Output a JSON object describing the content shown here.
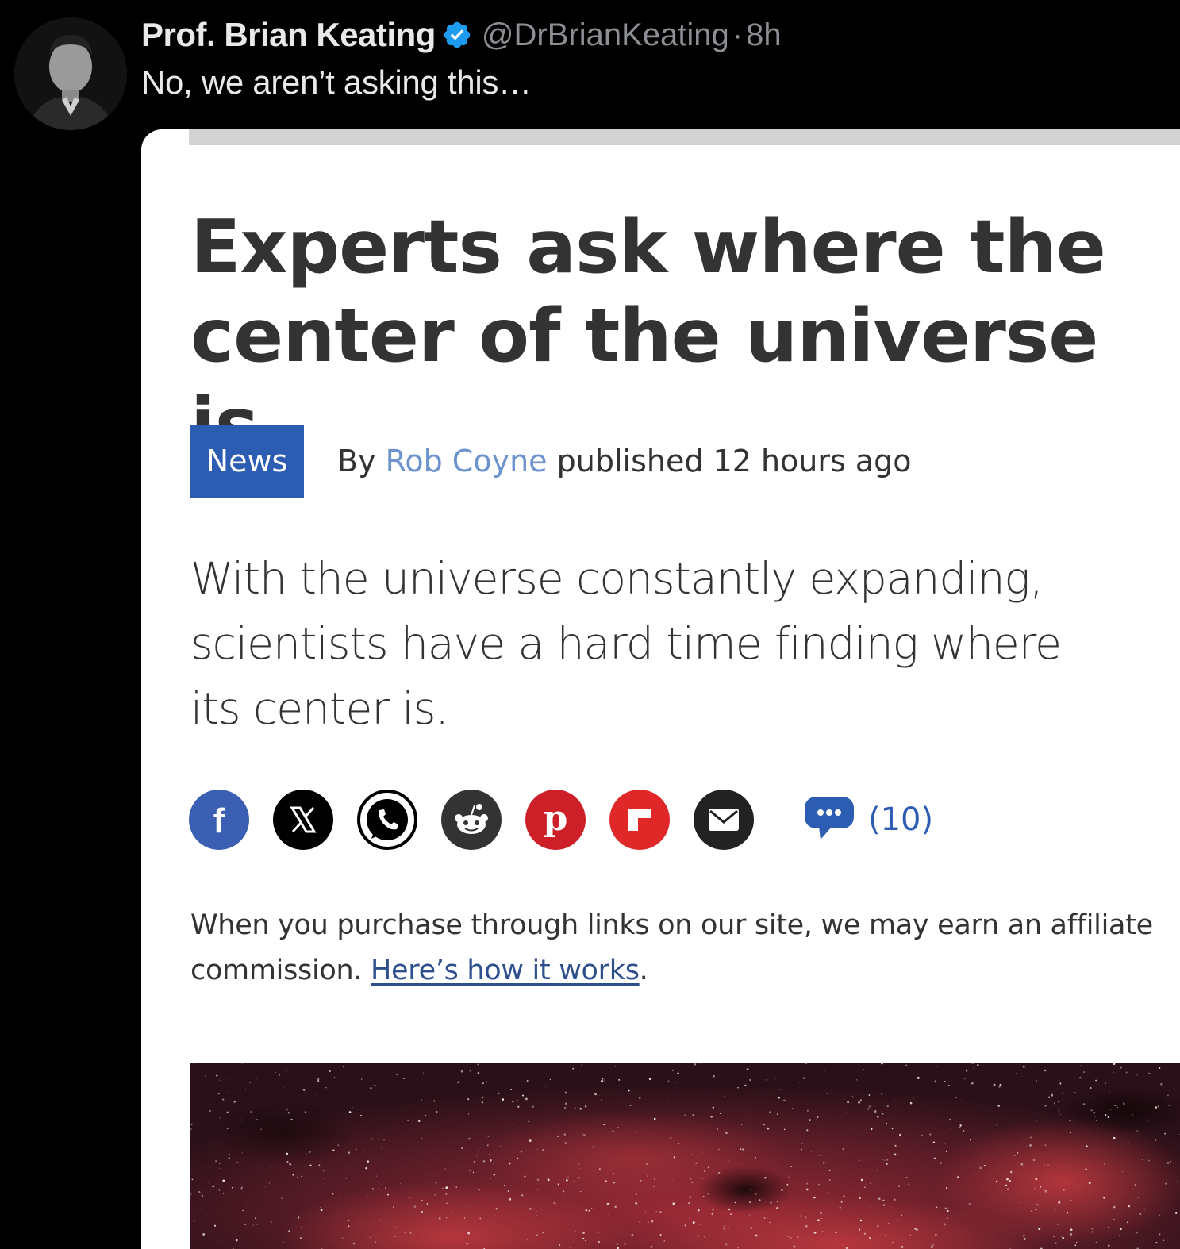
{
  "tweet": {
    "author_name": "Prof. Brian Keating",
    "handle": "@DrBrianKeating",
    "separator": "·",
    "time": "8h",
    "text": "No, we aren’t asking this…",
    "verified_icon": "verified-badge-icon",
    "verified_color": "#1d9bf0"
  },
  "article": {
    "headline": "Experts ask where the center of the universe is",
    "category": "News",
    "byline_prefix": "By",
    "author": "Rob Coyne",
    "published": "published 12 hours ago",
    "standfirst": "With the universe constantly expanding, scientists have a hard time finding where its center is.",
    "share": {
      "icons": [
        "facebook-icon",
        "x-icon",
        "whatsapp-icon",
        "reddit-icon",
        "pinterest-icon",
        "flipboard-icon",
        "email-icon"
      ],
      "comment_icon": "comment-bubble-icon",
      "comment_count": "(10)"
    },
    "affiliate_text": "When you purchase through links on our site, we may earn an affiliate commission.",
    "affiliate_link": "Here’s how it works",
    "affiliate_end": ".",
    "accent_color": "#2d5db2"
  }
}
